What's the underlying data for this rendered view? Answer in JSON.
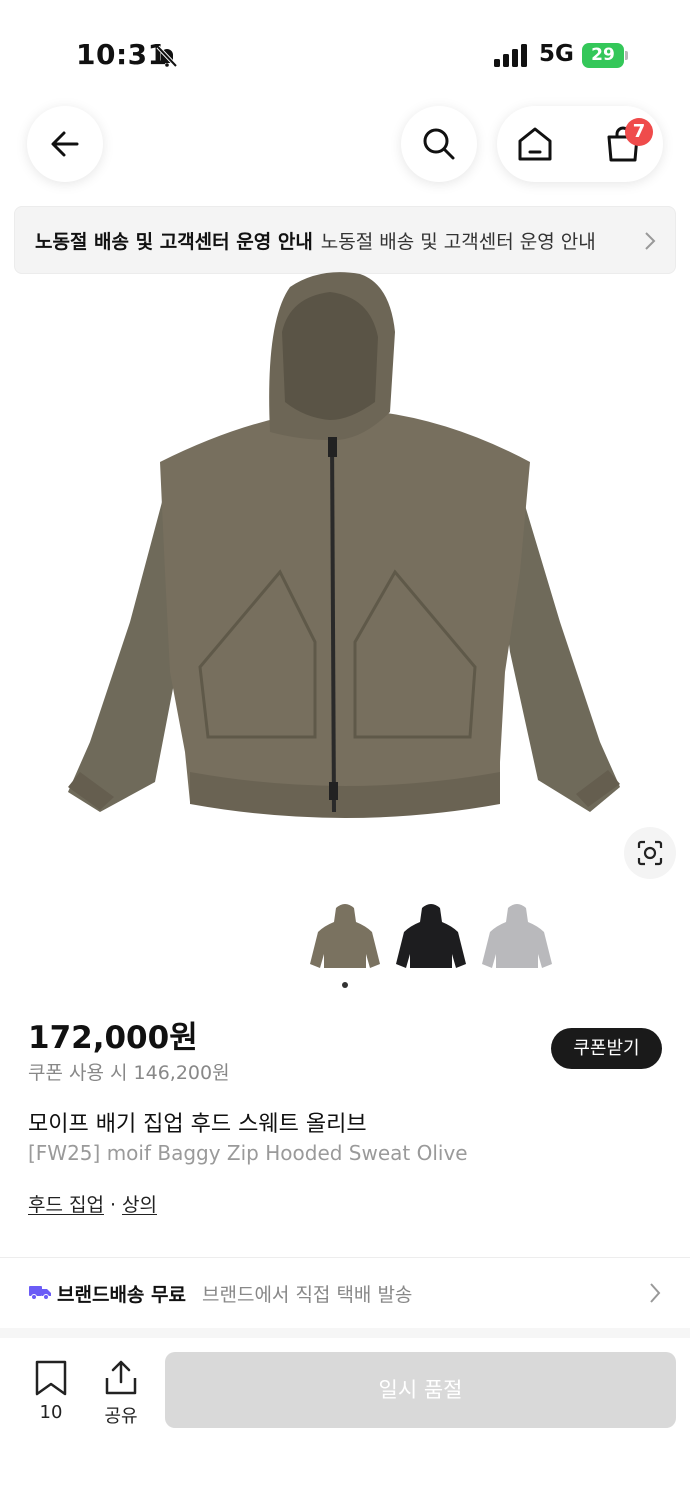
{
  "status": {
    "time": "10:31",
    "network": "5G",
    "battery": "29"
  },
  "header": {
    "cart_count": "7"
  },
  "notice": {
    "title": "노동절 배송 및 고객센터 운영 안내",
    "text": "노동절 배송 및 고객센터 운영 안내"
  },
  "product": {
    "image_alt": "올리브 후드 집업",
    "thumbnails": [
      {
        "color": "#7a7260"
      },
      {
        "color": "#1d1d1f"
      },
      {
        "color": "#b9b9bc"
      }
    ],
    "price": "172,000원",
    "coupon_price": "쿠폰 사용 시 146,200원",
    "coupon_button": "쿠폰받기",
    "title_ko": "모이프 배기 집업 후드 스웨트 올리브",
    "title_en": "[FW25] moif Baggy Zip Hooded Sweat Olive",
    "categories": [
      "후드 집업",
      "상의"
    ],
    "category_separator": "·"
  },
  "shipping": {
    "title": "브랜드배송 무료",
    "text": "브랜드에서 직접 택배 발송",
    "icon_color": "#6b5cf6"
  },
  "bottom_bar": {
    "bookmark_count": "10",
    "share_label": "공유",
    "soldout_label": "일시 품절"
  }
}
